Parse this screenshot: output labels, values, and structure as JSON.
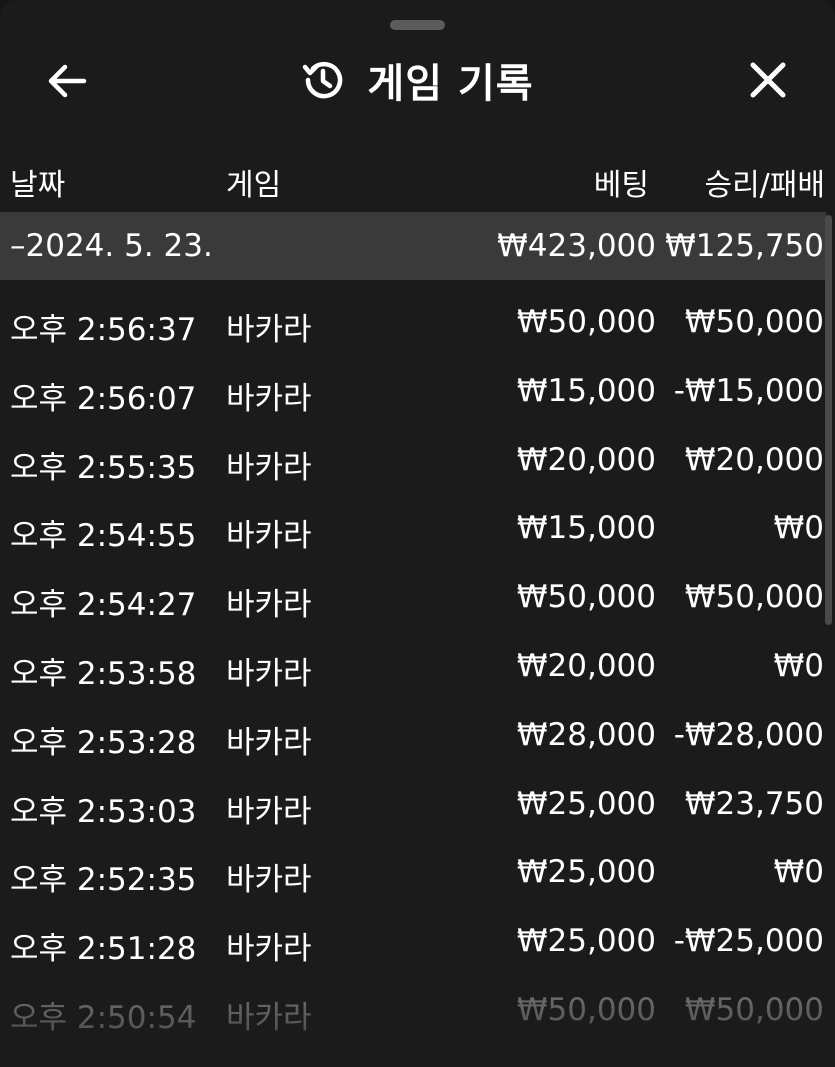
{
  "header": {
    "title": "게임 기록",
    "back_icon": "arrow-left-icon",
    "history_icon": "history-clock-icon",
    "close_icon": "close-icon"
  },
  "columns": {
    "date": "날짜",
    "game": "게임",
    "bet": "베팅",
    "result": "승리/패배"
  },
  "summary": {
    "date": "–2024. 5. 23.",
    "bet": "₩423,000",
    "result": "₩125,750"
  },
  "rows": [
    {
      "time": "오후 2:56:37",
      "game": "바카라",
      "bet": "₩50,000",
      "result": "₩50,000"
    },
    {
      "time": "오후 2:56:07",
      "game": "바카라",
      "bet": "₩15,000",
      "result": "-₩15,000"
    },
    {
      "time": "오후 2:55:35",
      "game": "바카라",
      "bet": "₩20,000",
      "result": "₩20,000"
    },
    {
      "time": "오후 2:54:55",
      "game": "바카라",
      "bet": "₩15,000",
      "result": "₩0"
    },
    {
      "time": "오후 2:54:27",
      "game": "바카라",
      "bet": "₩50,000",
      "result": "₩50,000"
    },
    {
      "time": "오후 2:53:58",
      "game": "바카라",
      "bet": "₩20,000",
      "result": "₩0"
    },
    {
      "time": "오후 2:53:28",
      "game": "바카라",
      "bet": "₩28,000",
      "result": "-₩28,000"
    },
    {
      "time": "오후 2:53:03",
      "game": "바카라",
      "bet": "₩25,000",
      "result": "₩23,750"
    },
    {
      "time": "오후 2:52:35",
      "game": "바카라",
      "bet": "₩25,000",
      "result": "₩0"
    },
    {
      "time": "오후 2:51:28",
      "game": "바카라",
      "bet": "₩25,000",
      "result": "-₩25,000"
    },
    {
      "time": "오후 2:50:54",
      "game": "바카라",
      "bet": "₩50,000",
      "result": "₩50,000"
    }
  ],
  "colors": {
    "background": "#1b1b1b",
    "summary_row": "#3a3a3a",
    "text": "#ffffff"
  }
}
